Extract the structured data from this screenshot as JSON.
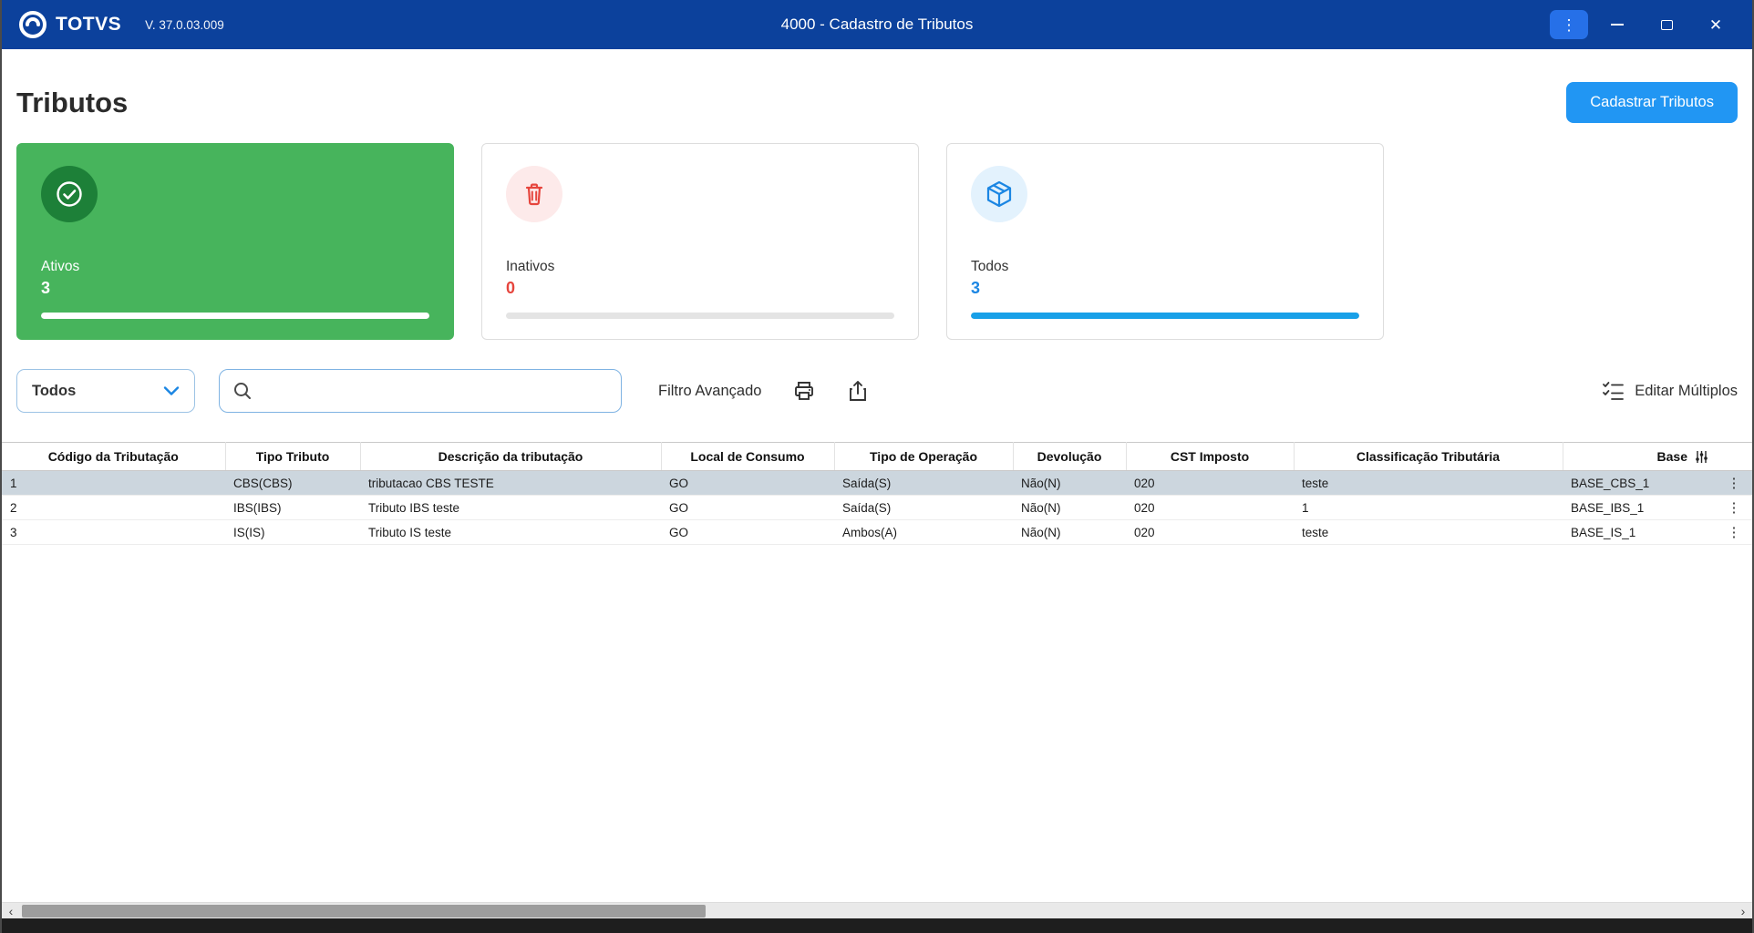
{
  "colors": {
    "titlebar_bg": "#0c419c",
    "menu_button": "#2670e8",
    "primary": "#2196f3",
    "green": "#47b45c",
    "green_dark": "#1d8038",
    "red": "#e6453d",
    "red_light": "#fdeaea",
    "blue": "#1b86e3",
    "blue_light": "#e3f2fd",
    "accent_bar": "#18a0e8",
    "row_selected": "#ccd6de"
  },
  "titlebar": {
    "brand": "TOTVS",
    "version": "V. 37.0.03.009",
    "title": "4000 - Cadastro de Tributos"
  },
  "icons": {
    "menu_kebab": "⋮",
    "close": "✕",
    "row_menu": "⋮",
    "scroll_left": "‹",
    "scroll_right": "›"
  },
  "page": {
    "title": "Tributos",
    "register_button_label": "Cadastrar Tributos"
  },
  "cards": [
    {
      "id": "ativos",
      "label": "Ativos",
      "count": "3",
      "progress": 100,
      "icon": "badge-check-icon",
      "state": "selected"
    },
    {
      "id": "inativos",
      "label": "Inativos",
      "count": "0",
      "progress": 0,
      "icon": "trash-icon",
      "state": "default"
    },
    {
      "id": "todos",
      "label": "Todos",
      "count": "3",
      "progress": 100,
      "icon": "package-icon",
      "state": "default"
    }
  ],
  "filter_bar": {
    "type_select_value": "Todos",
    "search_placeholder": "",
    "advanced_filter_label": "Filtro Avançado",
    "edit_multiple_label": "Editar Múltiplos"
  },
  "table": {
    "columns": [
      "Código da Tributação",
      "Tipo Tributo",
      "Descrição da tributação",
      "Local de Consumo",
      "Tipo de Operação",
      "Devolução",
      "CST Imposto",
      "Classificação Tributária",
      "Base"
    ],
    "rows": [
      [
        "1",
        "CBS(CBS)",
        "tributacao CBS TESTE",
        "GO",
        "Saída(S)",
        "Não(N)",
        "020",
        "teste",
        "BASE_CBS_1"
      ],
      [
        "2",
        "IBS(IBS)",
        "Tributo IBS teste",
        "GO",
        "Saída(S)",
        "Não(N)",
        "020",
        "1",
        "BASE_IBS_1"
      ],
      [
        "3",
        "IS(IS)",
        "Tributo IS teste",
        "GO",
        "Ambos(A)",
        "Não(N)",
        "020",
        "teste",
        "BASE_IS_1"
      ]
    ]
  }
}
